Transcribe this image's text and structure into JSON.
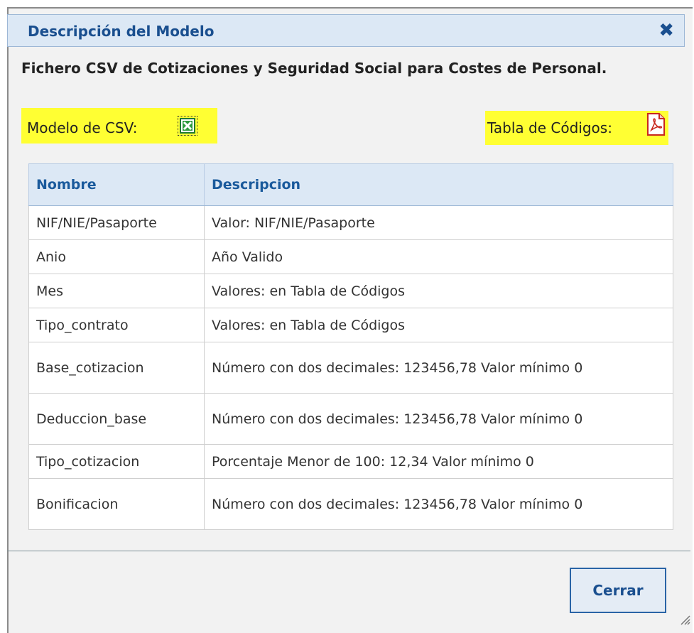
{
  "dialog": {
    "title": "Descripción del Modelo",
    "close_icon": "close-x-icon",
    "description": "Fichero CSV de Cotizaciones y Seguridad Social para Costes de Personal.",
    "csv_model_label": "Modelo de CSV:",
    "csv_model_icon": "excel-file-icon",
    "codes_table_label": "Tabla de Códigos:",
    "codes_table_icon": "pdf-file-icon",
    "highlight_color": "#ffff33",
    "accent_color": "#1a4f8f",
    "close_button_label": "Cerrar"
  },
  "table": {
    "headers": [
      "Nombre",
      "Descripcion"
    ],
    "rows": [
      {
        "name": "NIF/NIE/Pasaporte",
        "desc": "Valor: NIF/NIE/Pasaporte"
      },
      {
        "name": "Anio",
        "desc": "Año Valido"
      },
      {
        "name": "Mes",
        "desc": "Valores: en Tabla de Códigos"
      },
      {
        "name": "Tipo_contrato",
        "desc": "Valores: en Tabla de Códigos"
      },
      {
        "name": "Base_cotizacion",
        "desc": "Número con dos decimales: 123456,78 Valor mínimo 0"
      },
      {
        "name": "Deduccion_base",
        "desc": "Número con dos decimales: 123456,78 Valor mínimo 0"
      },
      {
        "name": "Tipo_cotizacion",
        "desc": "Porcentaje Menor de 100: 12,34 Valor mínimo 0"
      },
      {
        "name": "Bonificacion",
        "desc": "Número con dos decimales: 123456,78 Valor mínimo 0"
      }
    ]
  }
}
